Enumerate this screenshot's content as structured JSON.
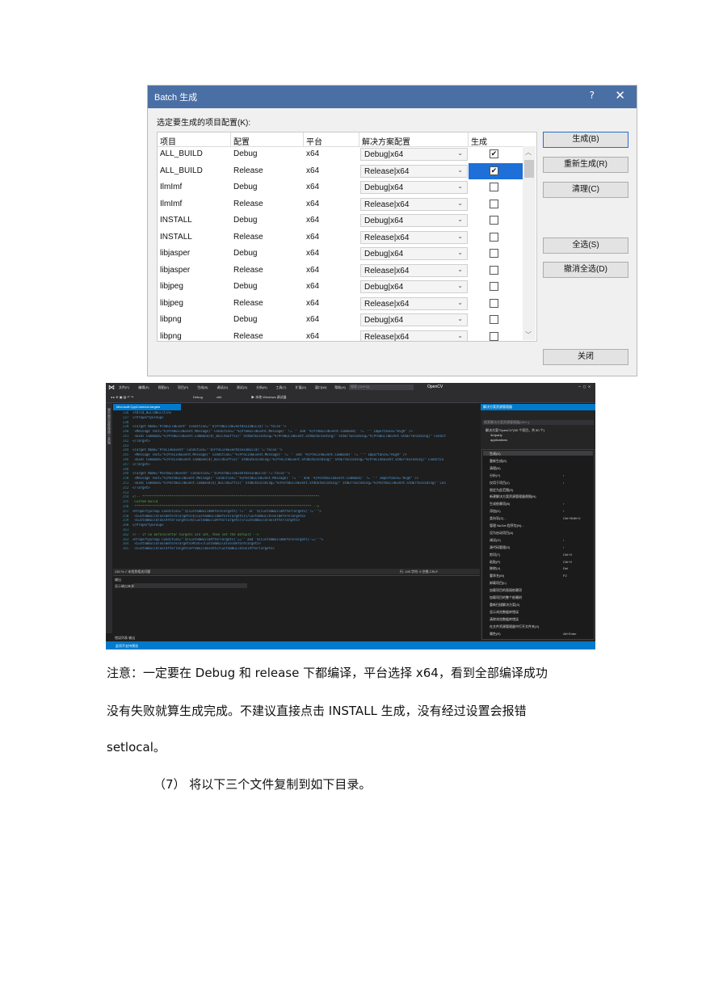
{
  "dialog": {
    "title": "Batch 生成",
    "help": "?",
    "close": "✕",
    "caption": "选定要生成的项目配置(K):",
    "columns": [
      "项目",
      "配置",
      "平台",
      "解决方案配置",
      "生成"
    ],
    "rows": [
      {
        "project": "ALL_BUILD",
        "config": "Debug",
        "platform": "x64",
        "solution": "Debug|x64",
        "build": true
      },
      {
        "project": "ALL_BUILD",
        "config": "Release",
        "platform": "x64",
        "solution": "Release|x64",
        "build": true
      },
      {
        "project": "IlmImf",
        "config": "Debug",
        "platform": "x64",
        "solution": "Debug|x64",
        "build": false
      },
      {
        "project": "IlmImf",
        "config": "Release",
        "platform": "x64",
        "solution": "Release|x64",
        "build": false
      },
      {
        "project": "INSTALL",
        "config": "Debug",
        "platform": "x64",
        "solution": "Debug|x64",
        "build": false
      },
      {
        "project": "INSTALL",
        "config": "Release",
        "platform": "x64",
        "solution": "Release|x64",
        "build": false
      },
      {
        "project": "libjasper",
        "config": "Debug",
        "platform": "x64",
        "solution": "Debug|x64",
        "build": false
      },
      {
        "project": "libjasper",
        "config": "Release",
        "platform": "x64",
        "solution": "Release|x64",
        "build": false
      },
      {
        "project": "libjpeg",
        "config": "Debug",
        "platform": "x64",
        "solution": "Debug|x64",
        "build": false
      },
      {
        "project": "libjpeg",
        "config": "Release",
        "platform": "x64",
        "solution": "Release|x64",
        "build": false
      },
      {
        "project": "libpng",
        "config": "Debug",
        "platform": "x64",
        "solution": "Debug|x64",
        "build": false
      },
      {
        "project": "libpng",
        "config": "Release",
        "platform": "x64",
        "solution": "Release|x64",
        "build": false
      }
    ],
    "buttons": {
      "build": "生成(B)",
      "rebuild": "重新生成(R)",
      "clean": "清理(C)",
      "select_all": "全选(S)",
      "deselect_all": "撤消全选(D)",
      "close": "关闭"
    }
  },
  "vs": {
    "menu": [
      "文件(F)",
      "编辑(E)",
      "视图(V)",
      "项目(P)",
      "生成(B)",
      "调试(D)",
      "测试(S)",
      "分析(N)",
      "工具(T)",
      "扩展(X)",
      "窗口(W)",
      "帮助(H)"
    ],
    "search_placeholder": "搜索 (Ctrl+Q)",
    "project_name": "OpenCV",
    "toolbar": {
      "config": "Debug",
      "platform": "x64",
      "debugger": "▶ 本地 Windows 调试器"
    },
    "editor_tab": "Microsoft.CppCommon.targets",
    "left_tabs": "服务器资源管理器  工具箱",
    "code_lines": [
      {
        "no": "236",
        "text": "<YDrc$_BuildBuiltin>"
      },
      {
        "no": "237",
        "text": "</PropertyGroup>"
      },
      {
        "no": "238",
        "text": ""
      },
      {
        "no": "239",
        "text": "<Target Name=\"PreBuildEvent\" Condition=\"'$(PreBuildEventUseInBuild)'!='false'\">"
      },
      {
        "no": "240",
        "text": "  <Message Text=\"%(PreBuildEvent.Message)\" Condition=\"'%(PreBuildEvent.Message)' != '' and '%(PreBuildEvent.Command)' != ''\" Importance=\"High\" />"
      },
      {
        "no": "241",
        "text": "  <Exec Command=\"%(PreBuildEvent.Command)$(_BuildSuffix)\" StdOutEncoding=\"%(PreBuildEvent.StdOutEncoding)\" StdErrEncoding=\"%(PreBuildEvent.StdErrEncoding)\" Condit"
      },
      {
        "no": "242",
        "text": "</Target>"
      },
      {
        "no": "243",
        "text": ""
      },
      {
        "no": "244",
        "text": "<Target Name=\"PreLinkEvent\" Condition=\"'$(PreLinkEventUseInBuild)'!='false'\">"
      },
      {
        "no": "245",
        "text": "  <Message Text=\"%(PreLinkEvent.Message)\" Condition=\"'%(PreLinkEvent.Message)' != '' and '%(PreLinkEvent.Command)' != ''\" Importance=\"High\" />"
      },
      {
        "no": "246",
        "text": "  <Exec Command=\"%(PreLinkEvent.Command)$(_BuildSuffix)\" StdOutEncoding=\"%(PreLinkEvent.StdOutEncoding)\" StdErrEncoding=\"%(PreLinkEvent.StdErrEncoding)\" Conditio"
      },
      {
        "no": "247",
        "text": "</Target>"
      },
      {
        "no": "248",
        "text": ""
      },
      {
        "no": "249",
        "text": "<Target Name=\"PostBuildEvent\" Condition=\"'$(PostBuildEventUseInBuild)'!='false'\">"
      },
      {
        "no": "250",
        "text": "  <Message Text=\"%(PostBuildEvent.Message)\" Condition=\"'%(PostBuildEvent.Message)' != '' and '%(PostBuildEvent.Command)' != ''\" Importance=\"High\" />"
      },
      {
        "no": "251",
        "text": "  <Exec Command=\"%(PostBuildEvent.Command)$(_BuildSuffix)\" StdOutEncoding=\"%(PostBuildEvent.StdOutEncoding)\" StdErrEncoding=\"%(PostBuildEvent.StdErrEncoding)\" Con"
      },
      {
        "no": "252",
        "text": "</Target>"
      },
      {
        "no": "253",
        "text": ""
      },
      {
        "no": "254",
        "text": "<!-- *******************************************************************************************"
      },
      {
        "no": "255",
        "text": "       Custom Build"
      },
      {
        "no": "256",
        "text": "     ******************************************************************************************* -->"
      },
      {
        "no": "257",
        "text": "<PropertyGroup Condition=\"'$(CustomBuildBeforeTargets)'!='' or '$(CustomBuildAfterTargets)'!=''\">"
      },
      {
        "no": "258",
        "text": "  <CustomBuildToolBeforeTargets>$(CustomBuildBeforeTargets)</CustomBuildToolBeforeTargets>"
      },
      {
        "no": "259",
        "text": "  <CustomBuildToolAfterTargets>$(CustomBuildAfterTargets)</CustomBuildToolAfterTargets>"
      },
      {
        "no": "260",
        "text": "</PropertyGroup>"
      },
      {
        "no": "261",
        "text": ""
      },
      {
        "no": "262",
        "text": "<!-- If no before/after targets are set, then set the default -->"
      },
      {
        "no": "263",
        "text": "<PropertyGroup Condition=\"'$(CustomBuildAfterTargets)'=='' and '$(CustomBuildBeforeTargets)'==''\">"
      },
      {
        "no": "264",
        "text": "  <CustomBuildToolBeforeTargets>Midl</CustomBuildToolBeforeTargets>"
      },
      {
        "no": "265",
        "text": "  <CustomBuildToolAfterTargets>PreBuildEvent</CustomBuildToolAfterTargets>"
      }
    ],
    "editor_status": "130 %   ✓ 未找到相关问题",
    "editor_position": "行: 149   字符: 5   空格   CRLF",
    "output_title": "输出",
    "output_source_label": "显示输出来源(S):",
    "output_tabs": "错误列表  输出",
    "solution_title": "解决方案资源管理器",
    "solution_search": "搜索解决方案资源管理器(Ctrl+;)",
    "tree": [
      "解决方案\"OpenCV\"(50 个项目，共 50 个)",
      "3rdparty",
      "applications"
    ],
    "context_menu": [
      {
        "label": "生成(U)",
        "shortcut": ""
      },
      {
        "label": "重新生成(E)",
        "shortcut": ""
      },
      {
        "label": "清理(N)",
        "shortcut": ""
      },
      {
        "label": "分析(Y)",
        "shortcut": "›"
      },
      {
        "label": "仅用于项目(J)",
        "shortcut": "›"
      },
      {
        "label": "限定为此范围(S)",
        "shortcut": ""
      },
      {
        "label": "新建解决方案资源管理器视图(N)",
        "shortcut": ""
      },
      {
        "label": "生成依赖项(B)",
        "shortcut": "›"
      },
      {
        "label": "添加(D)",
        "shortcut": "›"
      },
      {
        "label": "类向导(Z)...",
        "shortcut": "Ctrl+Shift+X"
      },
      {
        "label": "管理 NuGet 程序包(N)...",
        "shortcut": ""
      },
      {
        "label": "设为启动项目(A)",
        "shortcut": ""
      },
      {
        "label": "调试(G)",
        "shortcut": "›"
      },
      {
        "label": "源代码管理(S)",
        "shortcut": "›"
      },
      {
        "label": "剪切(T)",
        "shortcut": "Ctrl+X"
      },
      {
        "label": "粘贴(P)",
        "shortcut": "Ctrl+V"
      },
      {
        "label": "移除(V)",
        "shortcut": "Del"
      },
      {
        "label": "重命名(M)",
        "shortcut": "F2"
      },
      {
        "label": "卸载项目(L)",
        "shortcut": ""
      },
      {
        "label": "加载项目的直接依赖项",
        "shortcut": ""
      },
      {
        "label": "加载项目的整个依赖树",
        "shortcut": ""
      },
      {
        "label": "重新扫描解决方案(S)",
        "shortcut": ""
      },
      {
        "label": "显示浏览数据库错误",
        "shortcut": ""
      },
      {
        "label": "清除浏览数据库错误",
        "shortcut": ""
      },
      {
        "label": "在文件资源管理器中打开文件夹(X)",
        "shortcut": ""
      },
      {
        "label": "属性(R)",
        "shortcut": "Alt+Enter"
      }
    ],
    "statusbar": "此项不支持预览"
  },
  "text": {
    "note_line1": "注意：一定要在 Debug 和 release 下都编译，平台选择 x64，看到全部编译成功",
    "note_line2": "没有失败就算生成完成。不建议直接点击 INSTALL 生成，没有经过设置会报错",
    "note_line3": "setlocal。",
    "step": "（7）   将以下三个文件复制到如下目录。"
  }
}
